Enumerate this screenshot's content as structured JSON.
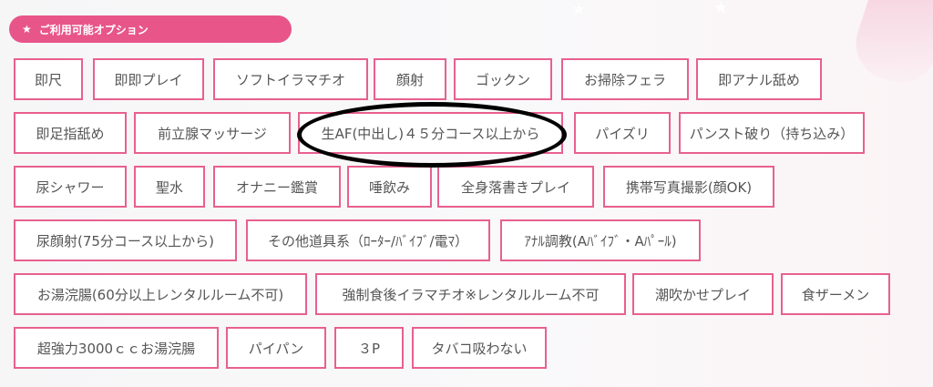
{
  "header": {
    "icon": "star-icon",
    "title": "ご利用可能オプション"
  },
  "options": [
    "即尺",
    "即即プレイ",
    "ソフトイラマチオ",
    "顔射",
    "ゴックン",
    "お掃除フェラ",
    "即アナル舐め",
    "即足指舐め",
    "前立腺マッサージ",
    "生AF(中出し)４５分コース以上から",
    "パイズリ",
    "パンスト破り（持ち込み）",
    "尿シャワー",
    "聖水",
    "オナニー鑑賞",
    "唾飲み",
    "全身落書きプレイ",
    "携帯写真撮影(顔OK)",
    "尿顔射(75分コース以上から)",
    "その他道具系（ﾛｰﾀｰ/ﾊﾞｲﾌﾞ/電ﾏ）",
    "ｱﾅﾙ調教(Aﾊﾞｲﾌﾞ・Aﾊﾟｰﾙ)",
    "お湯浣腸(60分以上レンタルルーム不可)",
    "強制食後イラマチオ※レンタルルーム不可",
    "潮吹かせプレイ",
    "食ザーメン",
    "超強力3000ｃｃお湯浣腸",
    "パイパン",
    "３P",
    "タバコ吸わない"
  ],
  "colors": {
    "accent": "#e85589",
    "border": "#e8608f",
    "text": "#555555"
  }
}
